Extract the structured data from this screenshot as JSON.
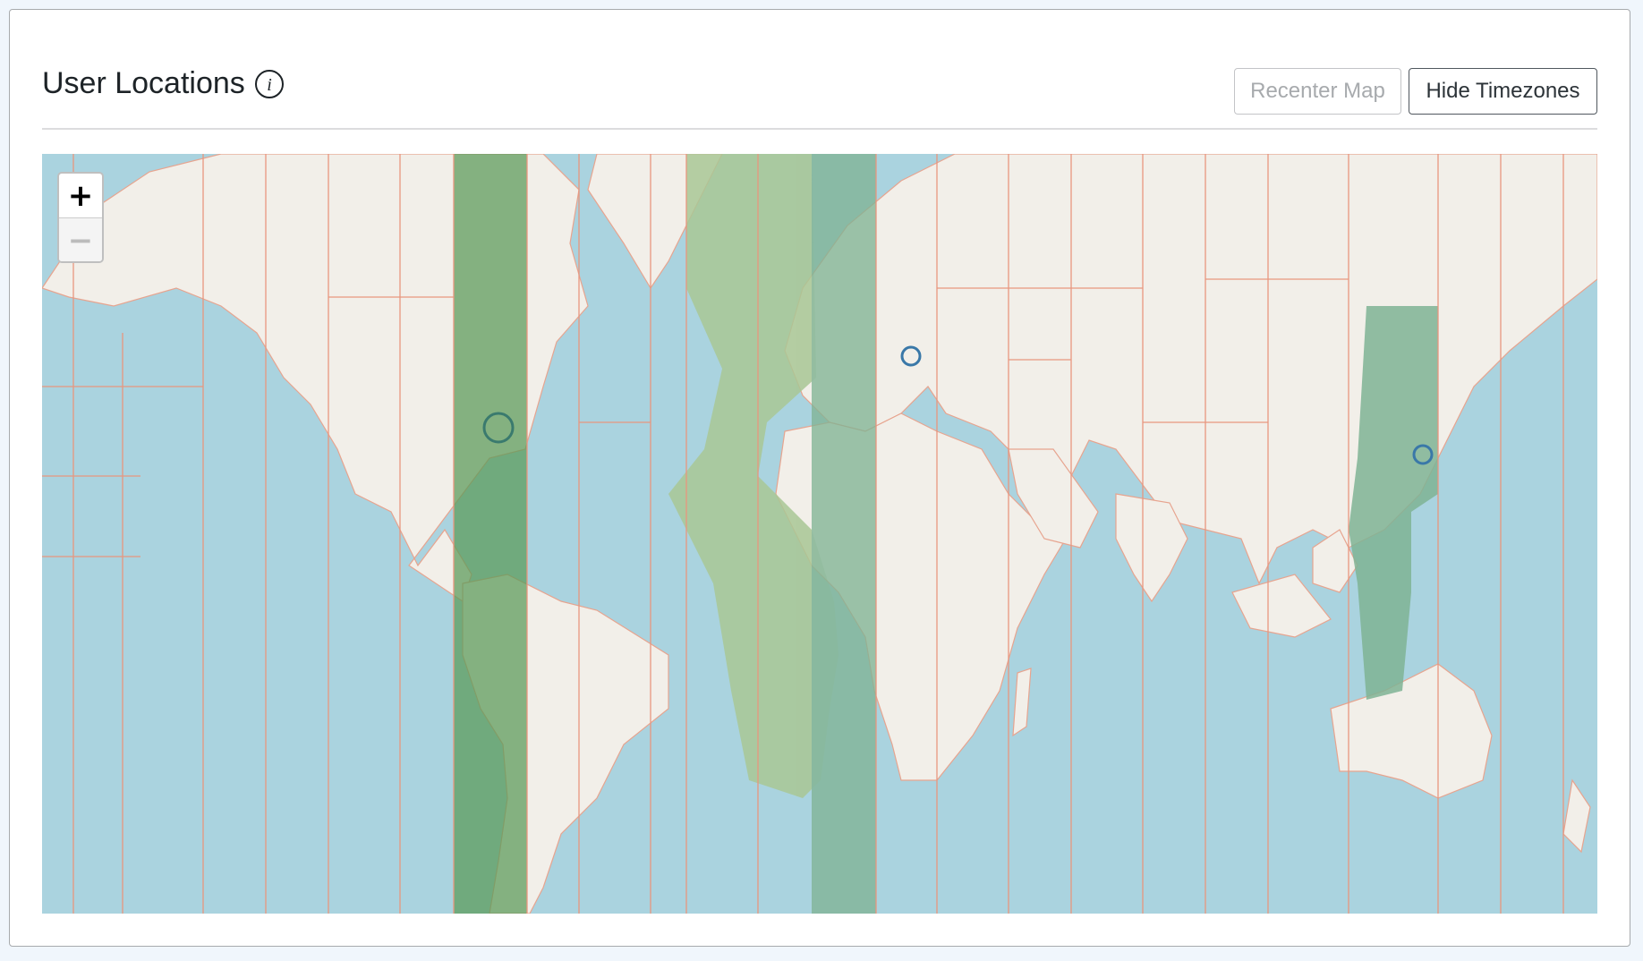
{
  "widget": {
    "title": "User Locations",
    "info_icon": "info-circle-icon"
  },
  "buttons": {
    "recenter_label": "Recenter Map",
    "recenter_disabled": true,
    "hide_timezones_label": "Hide Timezones"
  },
  "map": {
    "zoom_in_label": "+",
    "zoom_out_label": "−",
    "zoom_out_disabled": true,
    "timezones_visible": true
  },
  "colors": {
    "ocean": "#aad3df",
    "land": "#f2efe9",
    "timezone_border": "#e8967f",
    "highlight_dark": "#5a9a58",
    "highlight_light": "#a9c795",
    "highlight_teal": "#7fb394",
    "marker": "#3a78a8"
  }
}
